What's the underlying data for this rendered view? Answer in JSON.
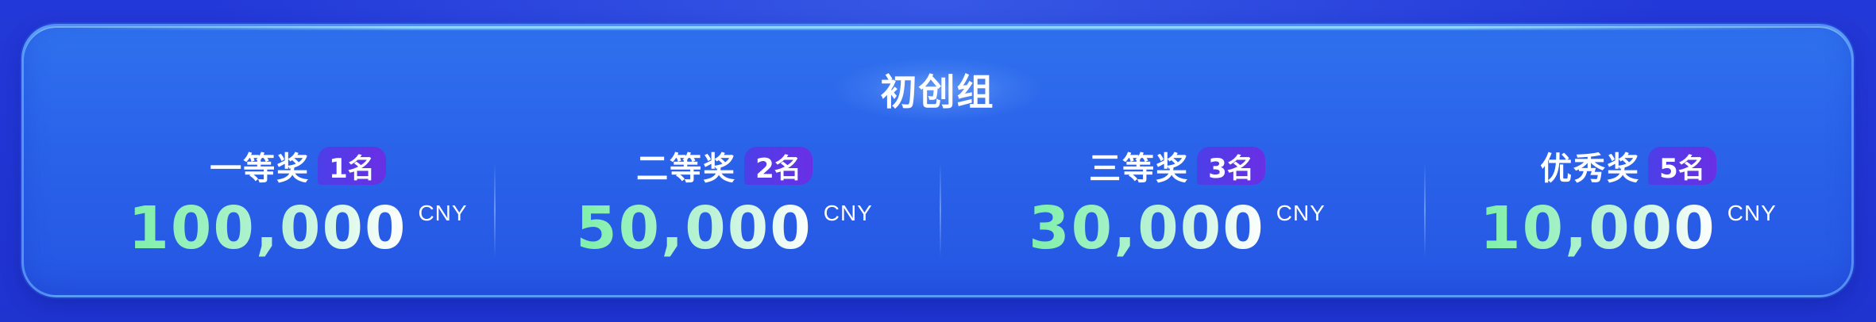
{
  "group_title": "初创组",
  "prizes": [
    {
      "name": "一等奖",
      "quota": "1名",
      "amount": "100,000",
      "unit": "CNY"
    },
    {
      "name": "二等奖",
      "quota": "2名",
      "amount": "50,000",
      "unit": "CNY"
    },
    {
      "name": "三等奖",
      "quota": "3名",
      "amount": "30,000",
      "unit": "CNY"
    },
    {
      "name": "优秀奖",
      "quota": "5名",
      "amount": "10,000",
      "unit": "CNY"
    }
  ],
  "colors": {
    "background": "#2236d6",
    "card": "#2a63ea",
    "badge_start": "#4c3fe8",
    "badge_end": "#6a2fe4",
    "amount_green": "#7df0a8",
    "text_white": "#ffffff"
  }
}
